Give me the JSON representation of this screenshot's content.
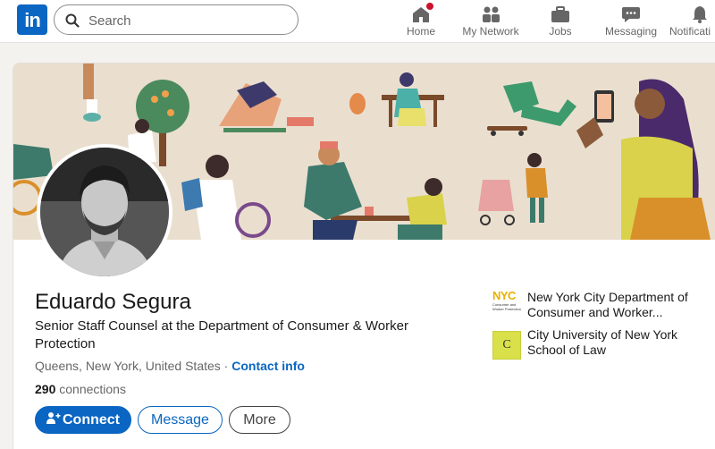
{
  "nav": {
    "search_placeholder": "Search",
    "items": [
      {
        "label": "Home",
        "icon": "home-icon"
      },
      {
        "label": "My Network",
        "icon": "network-icon"
      },
      {
        "label": "Jobs",
        "icon": "briefcase-icon"
      },
      {
        "label": "Messaging",
        "icon": "messaging-icon"
      },
      {
        "label": "Notificati",
        "icon": "bell-icon"
      }
    ],
    "logo_text": "in"
  },
  "profile": {
    "name": "Eduardo Segura",
    "headline": "Senior Staff Counsel at the Department of Consumer & Worker Protection",
    "location": "Queens, New York, United States",
    "separator": " · ",
    "contact_info": "Contact info",
    "connections_count": "290",
    "connections_label": " connections",
    "buttons": {
      "connect": "Connect",
      "message": "Message",
      "more": "More"
    },
    "experience": {
      "org": "New York City Department of Consumer and Worker...",
      "logo_text": "NYC",
      "logo_subtext": "Consumer and Worker Protection"
    },
    "education": {
      "org": "City University of New York School of Law",
      "logo_text": "C"
    }
  },
  "colors": {
    "brand": "#0a66c2",
    "badge": "#cb112d",
    "banner": "#eadfcf"
  }
}
